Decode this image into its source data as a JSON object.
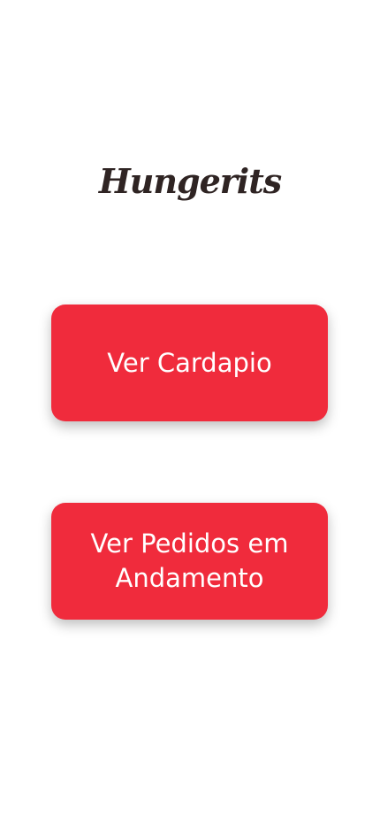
{
  "app": {
    "logo_text": "Hungerits"
  },
  "actions": {
    "menu_button_label": "Ver Cardapio",
    "orders_button_label": "Ver Pedidos em Andamento"
  },
  "colors": {
    "primary": "#f02b3c",
    "logo": "#2f2423",
    "background": "#ffffff"
  }
}
